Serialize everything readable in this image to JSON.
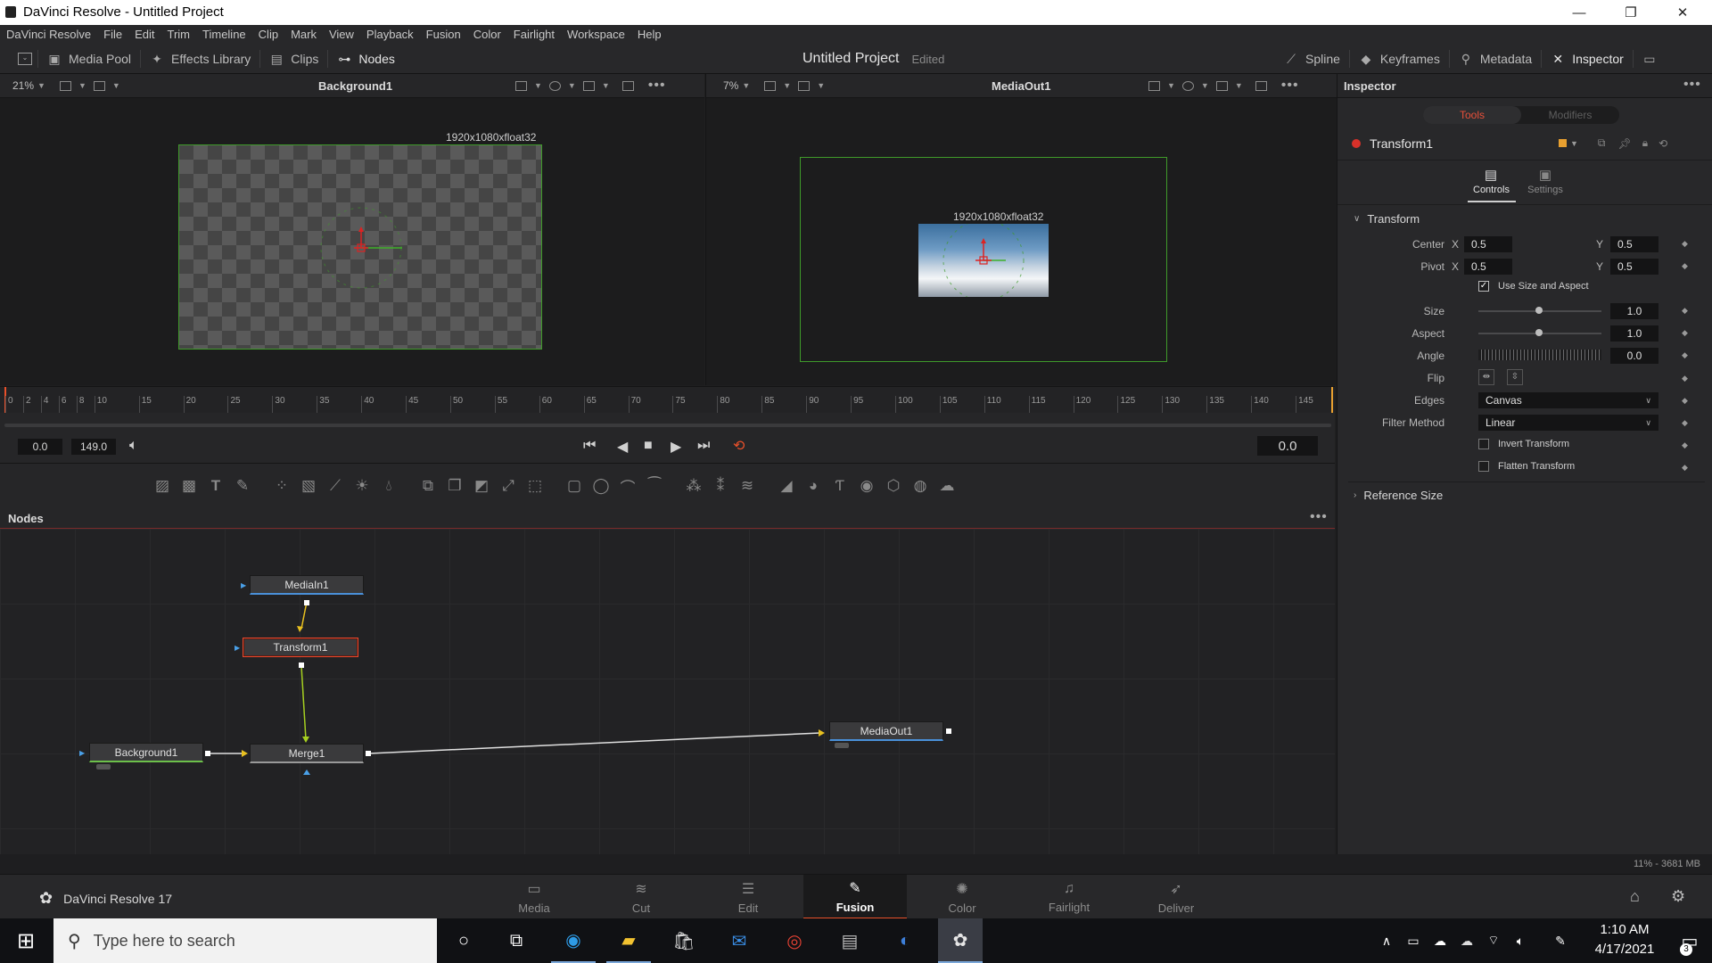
{
  "window": {
    "title": "DaVinci Resolve - Untitled Project",
    "minimize": "—",
    "maximize": "❐",
    "close": "✕"
  },
  "menu": [
    "DaVinci Resolve",
    "File",
    "Edit",
    "Trim",
    "Timeline",
    "Clip",
    "Mark",
    "View",
    "Playback",
    "Fusion",
    "Color",
    "Fairlight",
    "Workspace",
    "Help"
  ],
  "toolbar": {
    "left": [
      {
        "label": "Media Pool",
        "icon": "media-pool-icon"
      },
      {
        "label": "Effects Library",
        "icon": "effects-library-icon"
      },
      {
        "label": "Clips",
        "icon": "clips-icon"
      },
      {
        "label": "Nodes",
        "icon": "nodes-icon"
      }
    ],
    "project_title": "Untitled Project",
    "project_status": "Edited",
    "right": [
      {
        "label": "Spline",
        "icon": "spline-icon"
      },
      {
        "label": "Keyframes",
        "icon": "keyframes-icon"
      },
      {
        "label": "Metadata",
        "icon": "metadata-icon"
      },
      {
        "label": "Inspector",
        "icon": "inspector-icon"
      }
    ]
  },
  "viewer_left": {
    "zoom": "21%",
    "title": "Background1",
    "resolution": "1920x1080xfloat32"
  },
  "viewer_right": {
    "zoom": "7%",
    "title": "MediaOut1",
    "resolution": "1920x1080xfloat32"
  },
  "ruler": {
    "ticks": [
      "0",
      "2",
      "4",
      "6",
      "8",
      "10",
      "15",
      "20",
      "25",
      "30",
      "35",
      "40",
      "45",
      "50",
      "55",
      "60",
      "65",
      "70",
      "75",
      "80",
      "85",
      "90",
      "95",
      "100",
      "105",
      "110",
      "115",
      "120",
      "125",
      "130",
      "135",
      "140",
      "145"
    ]
  },
  "transport": {
    "start": "0.0",
    "end": "149.0",
    "current": "0.0"
  },
  "nodes_panel": {
    "title": "Nodes",
    "nodes": [
      "MediaIn1",
      "Transform1",
      "Background1",
      "Merge1",
      "MediaOut1"
    ]
  },
  "inspector": {
    "title": "Inspector",
    "tabs": [
      "Tools",
      "Modifiers"
    ],
    "tool_name": "Transform1",
    "subtabs": [
      "Controls",
      "Settings"
    ],
    "section": "Transform",
    "center_label": "Center",
    "center_x": "0.5",
    "center_y": "0.5",
    "pivot_label": "Pivot",
    "pivot_x": "0.5",
    "pivot_y": "0.5",
    "x_label": "X",
    "y_label": "Y",
    "use_size_label": "Use Size and Aspect",
    "size_label": "Size",
    "size_value": "1.0",
    "aspect_label": "Aspect",
    "aspect_value": "1.0",
    "angle_label": "Angle",
    "angle_value": "0.0",
    "flip_label": "Flip",
    "edges_label": "Edges",
    "edges_value": "Canvas",
    "filter_label": "Filter Method",
    "filter_value": "Linear",
    "invert_label": "Invert Transform",
    "flatten_label": "Flatten Transform",
    "ref_section": "Reference Size"
  },
  "status": {
    "memory": "11% - 3681 MB"
  },
  "app_brand": "DaVinci Resolve 17",
  "pages": [
    {
      "label": "Media",
      "icon": "media-page-icon"
    },
    {
      "label": "Cut",
      "icon": "cut-page-icon"
    },
    {
      "label": "Edit",
      "icon": "edit-page-icon"
    },
    {
      "label": "Fusion",
      "icon": "fusion-page-icon",
      "active": true
    },
    {
      "label": "Color",
      "icon": "color-page-icon"
    },
    {
      "label": "Fairlight",
      "icon": "fairlight-page-icon"
    },
    {
      "label": "Deliver",
      "icon": "deliver-page-icon"
    }
  ],
  "taskbar": {
    "search_placeholder": "Type here to search",
    "time": "1:10 AM",
    "date": "4/17/2021",
    "notifications": "3"
  },
  "colors": {
    "accent": "#e84a2f",
    "active_page": "#ffffff",
    "tools_tab": "#e8503a",
    "node_selected": "#e84a2f",
    "mediain_line": "#4a90d9",
    "background_line": "#6cc04a"
  }
}
